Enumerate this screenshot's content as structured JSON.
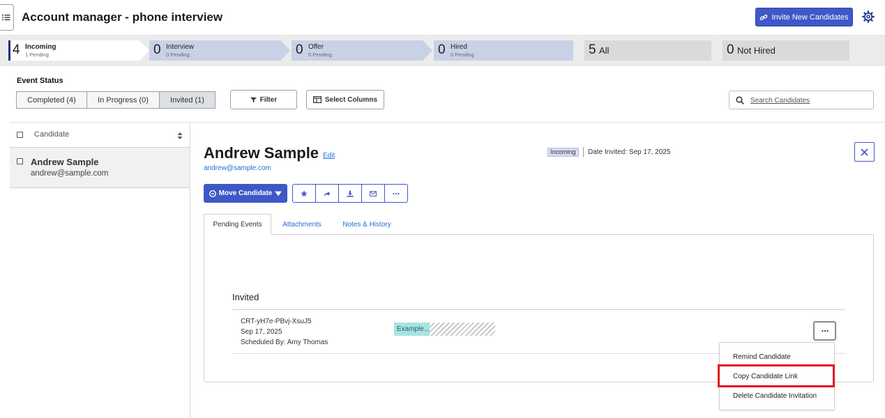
{
  "header": {
    "title": "Account manager - phone interview",
    "invite_label": "Invite New Candidates"
  },
  "stages": [
    {
      "count": "4",
      "label": "Incoming",
      "sub": "1 Pending",
      "active": true
    },
    {
      "count": "0",
      "label": "Interview",
      "sub": "0 Pending"
    },
    {
      "count": "0",
      "label": "Offer",
      "sub": "0 Pending"
    },
    {
      "count": "0",
      "label": "Hired",
      "sub": "0 Pending"
    },
    {
      "count": "5",
      "label": "All"
    },
    {
      "count": "0",
      "label": "Not Hired"
    }
  ],
  "event_status": {
    "title": "Event Status",
    "segments": [
      "Completed (4)",
      "In Progress (0)",
      "Invited (1)"
    ],
    "selected": "Invited (1)"
  },
  "toolbar": {
    "filter_label": "Filter",
    "columns_label": "Select Columns",
    "search_placeholder": "Search Candidates"
  },
  "list": {
    "column_header": "Candidate",
    "rows": [
      {
        "name": "Andrew Sample",
        "email": "andrew@sample.com"
      }
    ]
  },
  "detail": {
    "name": "Andrew Sample",
    "edit_label": "Edit",
    "email": "andrew@sample.com",
    "status_badge": "Incoming",
    "date_invited": "Date Invited: Sep 17, 2025",
    "move_label": "Move Candidate",
    "tabs": [
      "Pending Events",
      "Attachments",
      "Notes & History"
    ],
    "section_title": "Invited",
    "event": {
      "id": "CRT-yH7e-PBvj-XsuJ5",
      "date": "Sep 17, 2025",
      "scheduled_by": "Scheduled By: Amy Thomas",
      "tag": "Example..."
    }
  },
  "menu": {
    "items": [
      "Remind Candidate",
      "Copy Candidate Link",
      "Delete Candidate Invitation"
    ],
    "highlighted": "Copy Candidate Link"
  },
  "colors": {
    "primary": "#3f58c7",
    "stage_inactive": "#c8d1e6",
    "stage_other": "#dadada",
    "highlight": "#e3121f",
    "tag": "#a8e3e3"
  }
}
